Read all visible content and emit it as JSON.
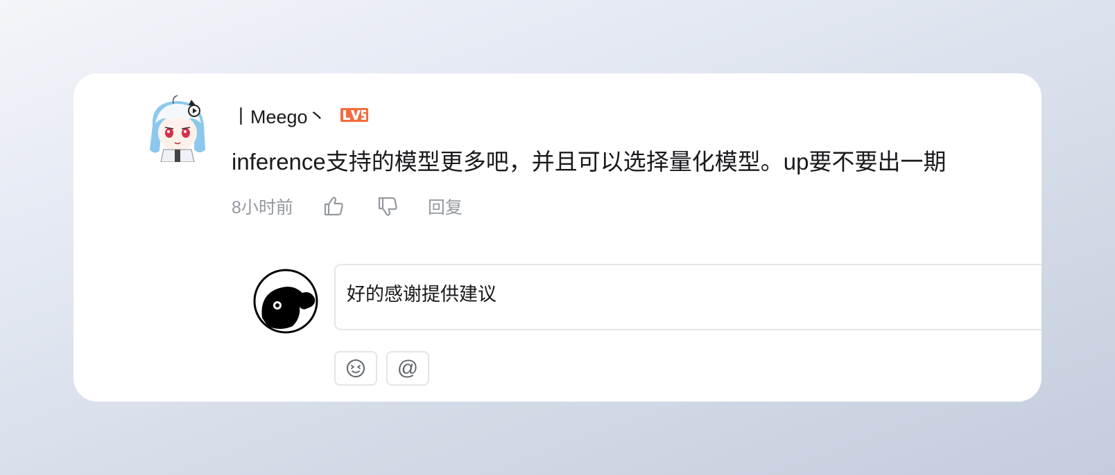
{
  "comment": {
    "username": "丨Meego丶",
    "level_badge": "LV5",
    "content": "inference支持的模型更多吧，并且可以选择量化模型。up要不要出一期",
    "time": "8小时前",
    "reply_label": "回复"
  },
  "reply_box": {
    "value": "好的感谢提供建议"
  },
  "toolbar": {
    "at_label": "@"
  },
  "colors": {
    "badge": "#f26c3d",
    "muted_text": "#9499a0",
    "primary_text": "#18191c",
    "border": "#e3e5e7"
  },
  "icons": [
    "avatar-anime",
    "level-badge-icon",
    "thumbs-up-icon",
    "thumbs-down-icon",
    "avatar-black-creature",
    "emoji-icon",
    "at-icon"
  ]
}
